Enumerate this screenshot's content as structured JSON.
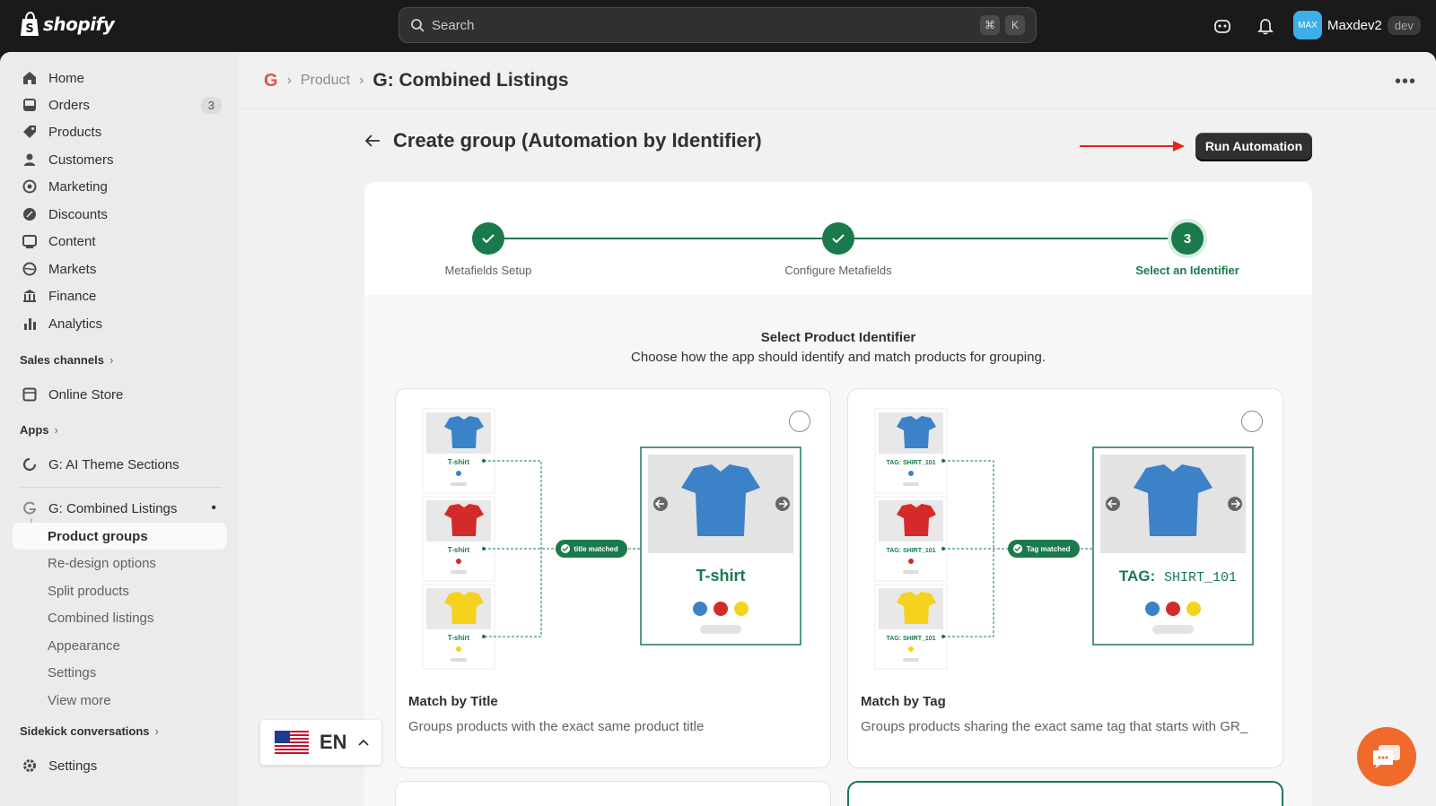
{
  "topbar": {
    "brand": "shopify",
    "search_placeholder": "Search",
    "shortcut_cmd": "⌘",
    "shortcut_key": "K",
    "user_initials": "MAX",
    "user_name": "Maxdev2",
    "user_tag": "dev"
  },
  "sidebar": {
    "main_items": [
      {
        "label": "Home",
        "icon": "home-icon"
      },
      {
        "label": "Orders",
        "icon": "inbox-icon",
        "badge": "3"
      },
      {
        "label": "Products",
        "icon": "tag-icon"
      },
      {
        "label": "Customers",
        "icon": "person-icon"
      },
      {
        "label": "Marketing",
        "icon": "target-icon"
      },
      {
        "label": "Discounts",
        "icon": "discount-icon"
      },
      {
        "label": "Content",
        "icon": "image-icon"
      },
      {
        "label": "Markets",
        "icon": "globe-icon"
      },
      {
        "label": "Finance",
        "icon": "bank-icon"
      },
      {
        "label": "Analytics",
        "icon": "bar-chart-icon"
      }
    ],
    "sales_channels_label": "Sales channels",
    "online_store": "Online Store",
    "apps_label": "Apps",
    "app_theme_sections": "G: AI Theme Sections",
    "app_combined": "G: Combined Listings",
    "sub_items": [
      "Product groups",
      "Re-design options",
      "Split products",
      "Combined listings",
      "Appearance",
      "Settings",
      "View more"
    ],
    "sidekick_label": "Sidekick conversations",
    "settings": "Settings"
  },
  "breadcrumb": {
    "icon_letter": "G",
    "parent": "Product",
    "current": "G: Combined Listings"
  },
  "page": {
    "title": "Create group (Automation by Identifier)",
    "run_button": "Run Automation"
  },
  "stepper": {
    "steps": [
      {
        "label": "Metafields Setup",
        "state": "done"
      },
      {
        "label": "Configure Metafields",
        "state": "done"
      },
      {
        "label": "Select an Identifier",
        "state": "current",
        "number": "3"
      }
    ]
  },
  "selection": {
    "title": "Select Product Identifier",
    "subtitle": "Choose how the app should identify and match products for grouping.",
    "options": [
      {
        "title": "Match by Title",
        "description": "Groups products with the exact same product title",
        "thumb_labels": [
          "T-shirt",
          "T-shirt",
          "T-shirt"
        ],
        "pill": "title matched",
        "result_label_bold": "T-shirt",
        "result_label_rest": ""
      },
      {
        "title": "Match by Tag",
        "description": "Groups products sharing the exact same tag that starts with GR_",
        "thumb_labels": [
          "TAG: SHIRT_101",
          "TAG: SHIRT_101",
          "TAG: SHIRT_101"
        ],
        "pill": "Tag matched",
        "result_label_bold": "TAG:",
        "result_label_rest": "SHIRT_101"
      }
    ]
  },
  "colors": {
    "accent_green": "#1a7a4c",
    "shirt_blue": "#3b82c8",
    "shirt_red": "#d42a2a",
    "shirt_yellow": "#f5d21e",
    "annotation_red": "#e8231d",
    "chat_orange": "#f06a2c"
  },
  "language": {
    "code": "EN"
  }
}
